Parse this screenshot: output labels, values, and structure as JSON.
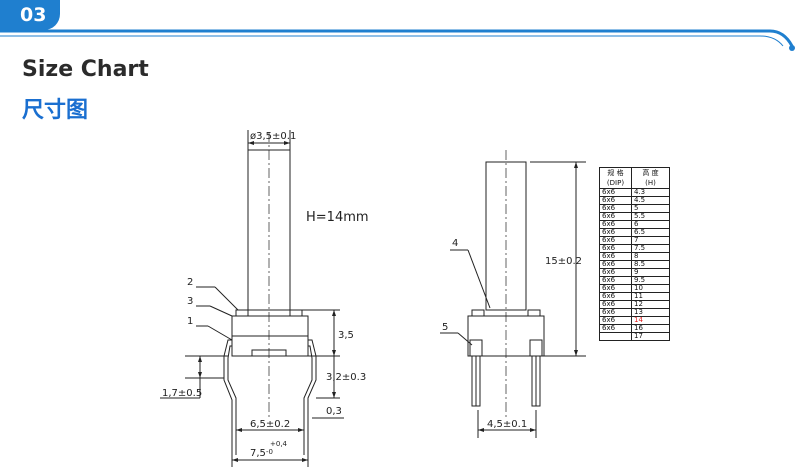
{
  "section_number": "03",
  "title_en": "Size Chart",
  "title_cn": "尺寸图",
  "colors": {
    "accent": "#1f7fcf",
    "title_cn": "#1a6fd0",
    "highlight": "#e02020"
  },
  "left_view": {
    "top_dim": "ø3,5±0.1",
    "height_note": "H=14mm",
    "callouts": [
      "2",
      "3",
      "1"
    ],
    "dim_3_5": "3,5",
    "dim_3_2": "3,2±0.3",
    "dim_1_7": "1,7±0.5",
    "dim_0_3": "0,3",
    "dim_6_5": "6,5±0.2",
    "dim_7_5_main": "7,5",
    "dim_7_5_upper": "+0,4",
    "dim_7_5_lower": "-0"
  },
  "right_view": {
    "callouts": [
      "4",
      "5"
    ],
    "dim_15": "15±0.2",
    "dim_4_5": "4,5±0.1"
  },
  "spec_table": {
    "header_col1_line1": "规 格",
    "header_col1_line2": "(DIP)",
    "header_col2_line1": "高    度",
    "header_col2_line2": "(H)",
    "rows": [
      {
        "spec": "6x6",
        "height": "4.3"
      },
      {
        "spec": "6x6",
        "height": "4.5"
      },
      {
        "spec": "6x6",
        "height": "5"
      },
      {
        "spec": "6x6",
        "height": "5.5"
      },
      {
        "spec": "6x6",
        "height": "6"
      },
      {
        "spec": "6x6",
        "height": "6.5"
      },
      {
        "spec": "6x6",
        "height": "7"
      },
      {
        "spec": "6x6",
        "height": "7.5"
      },
      {
        "spec": "6x6",
        "height": "8"
      },
      {
        "spec": "6x6",
        "height": "8.5"
      },
      {
        "spec": "6x6",
        "height": "9"
      },
      {
        "spec": "6x6",
        "height": "9.5"
      },
      {
        "spec": "6x6",
        "height": "10"
      },
      {
        "spec": "6x6",
        "height": "11"
      },
      {
        "spec": "6x6",
        "height": "12"
      },
      {
        "spec": "6x6",
        "height": "13"
      },
      {
        "spec": "6x6",
        "height": "14",
        "highlight": true
      },
      {
        "spec": "6x6",
        "height": "16"
      },
      {
        "spec": "",
        "height": "17"
      }
    ]
  }
}
